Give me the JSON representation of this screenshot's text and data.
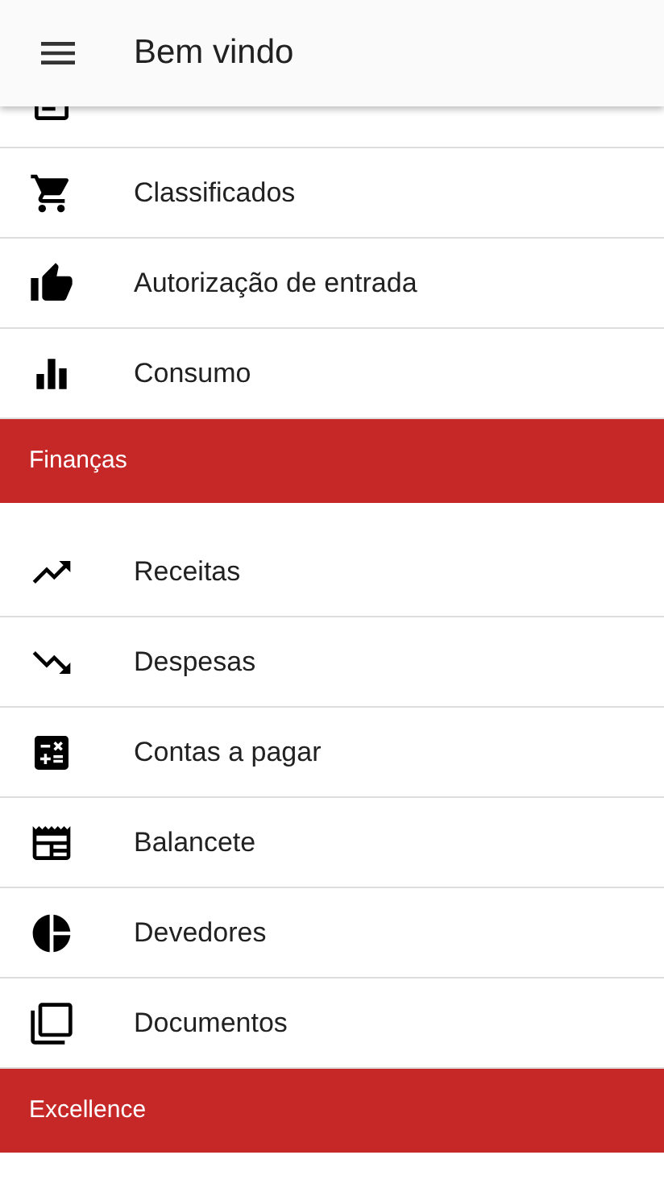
{
  "app_bar": {
    "title": "Bem vindo"
  },
  "menu": [
    {
      "kind": "clipped"
    },
    {
      "kind": "item",
      "label": "Classificados"
    },
    {
      "kind": "item",
      "label": "Autorização de entrada"
    },
    {
      "kind": "item",
      "label": "Consumo"
    },
    {
      "kind": "section",
      "label": "Finanças"
    },
    {
      "kind": "item",
      "label": "Receitas"
    },
    {
      "kind": "item",
      "label": "Despesas"
    },
    {
      "kind": "item",
      "label": "Contas a pagar"
    },
    {
      "kind": "item",
      "label": "Balancete"
    },
    {
      "kind": "item",
      "label": "Devedores"
    },
    {
      "kind": "item",
      "label": "Documentos"
    },
    {
      "kind": "section",
      "label": "Excellence"
    }
  ]
}
